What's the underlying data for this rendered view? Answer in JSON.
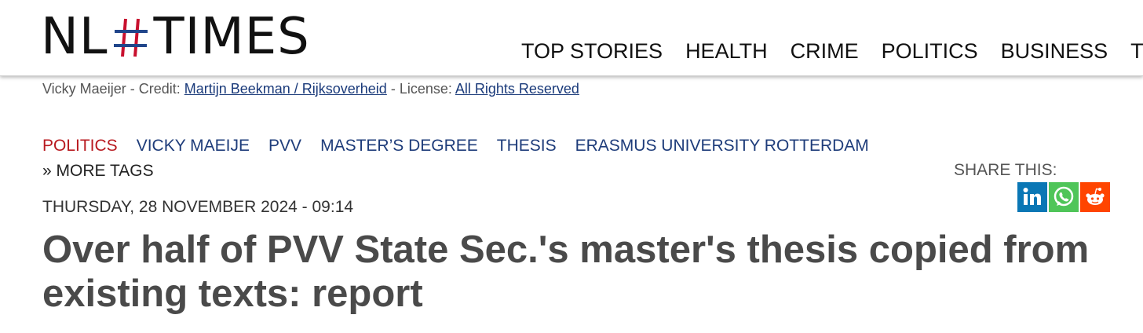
{
  "site": {
    "logo_left": "NL",
    "logo_right": "TIMES",
    "colors": {
      "hash_red": "#c8102e",
      "hash_blue": "#21468b"
    }
  },
  "nav": {
    "items": [
      {
        "label": "TOP STORIES"
      },
      {
        "label": "HEALTH"
      },
      {
        "label": "CRIME"
      },
      {
        "label": "POLITICS"
      },
      {
        "label": "BUSINESS"
      },
      {
        "label": "TECH"
      }
    ]
  },
  "credit": {
    "prefix": "Vicky Maeijer - Credit: ",
    "credit_link": "Martijn Beekman / Rijksoverheid",
    "license_prefix": " - License: ",
    "license_link": "All Rights Reserved"
  },
  "tags": {
    "items": [
      {
        "label": "POLITICS"
      },
      {
        "label": "VICKY MAEIJE"
      },
      {
        "label": "PVV"
      },
      {
        "label": "MASTER’S DEGREE"
      },
      {
        "label": "THESIS"
      },
      {
        "label": "ERASMUS UNIVERSITY ROTTERDAM"
      }
    ],
    "more": "» MORE TAGS"
  },
  "article": {
    "date": "THURSDAY, 28 NOVEMBER 2024 - 09:14",
    "headline": "Over half of PVV State Sec.'s master's thesis copied from existing texts: report"
  },
  "share": {
    "label": "SHARE THIS:",
    "buttons": [
      {
        "icon": "linkedin-icon",
        "color": "#0a77b5"
      },
      {
        "icon": "whatsapp-icon",
        "color": "#4fc559"
      },
      {
        "icon": "reddit-icon",
        "color": "#ff4500"
      }
    ]
  }
}
